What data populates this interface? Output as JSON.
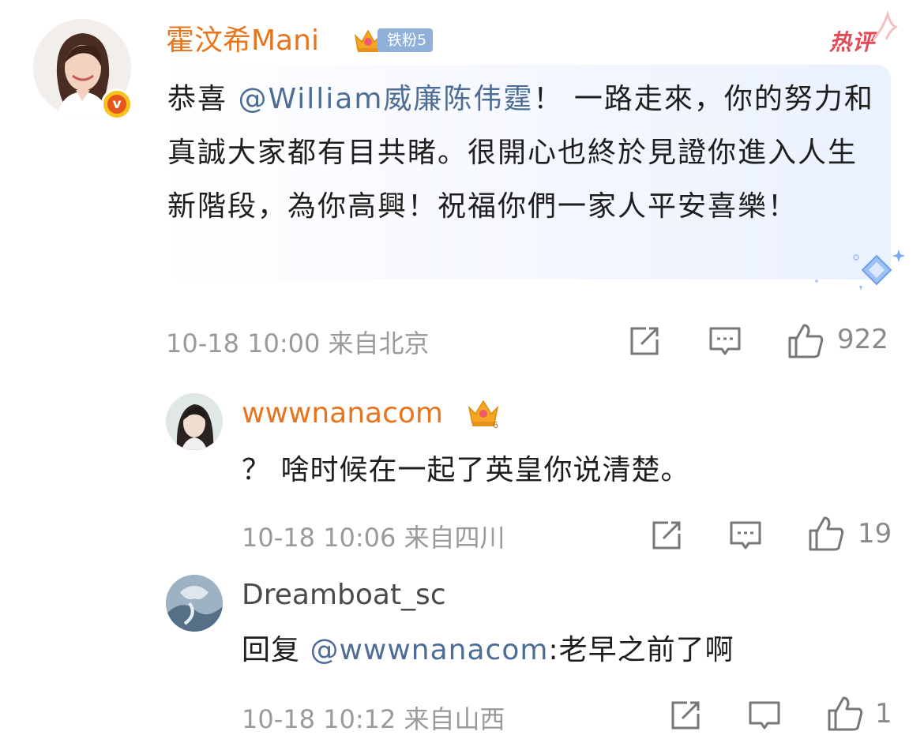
{
  "main_comment": {
    "username": "霍汶希Mani",
    "fan_badge": "铁粉5",
    "hot_label": "热评",
    "text_prefix": "恭喜 ",
    "mention": "@William威廉陈伟霆",
    "text_rest": "！ 一路走來，你的努力和真誠大家都有目共睹。很開心也終於見證你進入人生新階段，為你高興！祝福你們一家人平安喜樂！",
    "timestamp": "10-18 10:00",
    "location": "来自北京",
    "likes": "922",
    "verified_icon": "v-badge-icon"
  },
  "replies": [
    {
      "username": "wwwnanacom",
      "crown_level": "6",
      "text": "？ 啥时候在一起了英皇你说清楚。",
      "timestamp": "10-18 10:06",
      "location": "来自四川",
      "likes": "19"
    },
    {
      "username": "Dreamboat_sc",
      "reply_prefix": "回复 ",
      "mention": "@wwwnanacom",
      "reply_text": ":老早之前了啊",
      "timestamp": "10-18 10:12",
      "location": "来自山西",
      "likes": "1"
    }
  ],
  "colors": {
    "username_orange": "#e8741d",
    "mention_blue": "#4d6d96",
    "meta_gray": "#9a9a9a",
    "hot_red": "#e24a55",
    "badge_blue": "#8fb0d8"
  }
}
